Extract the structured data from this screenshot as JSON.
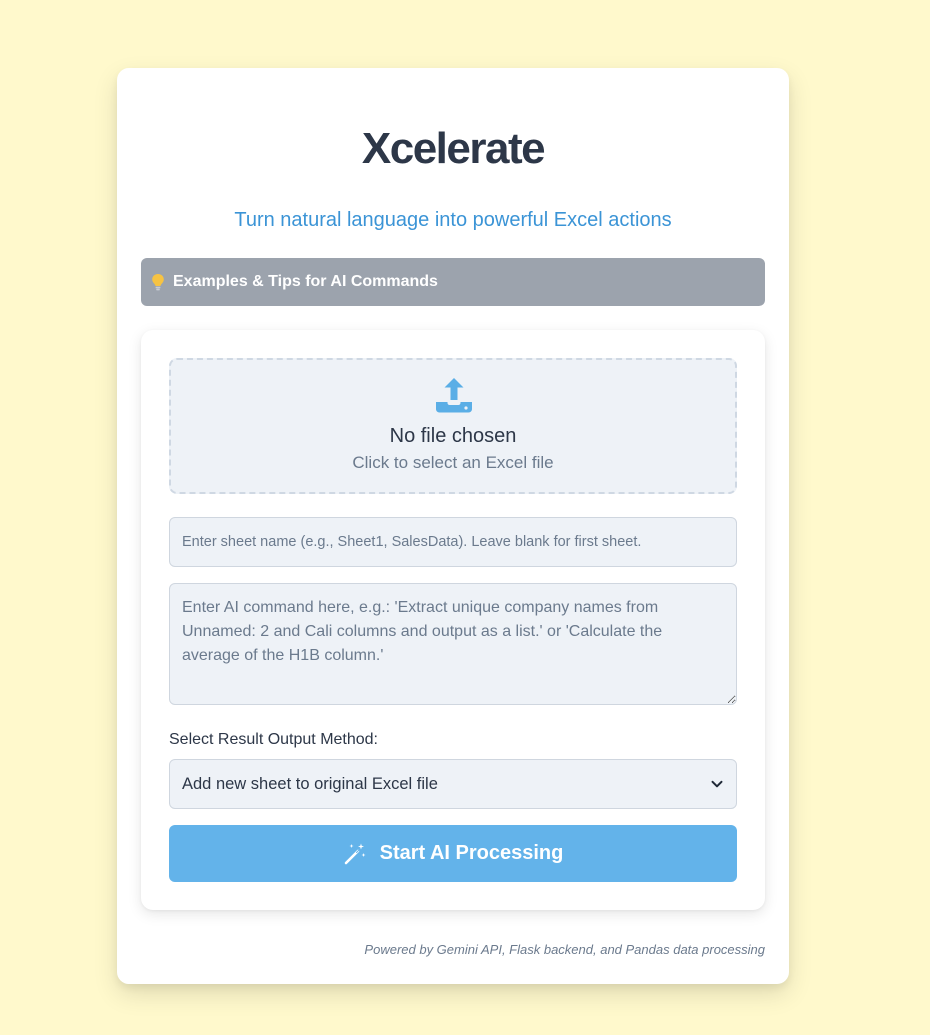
{
  "app": {
    "title": "Xcelerate",
    "subtitle": "Turn natural language into powerful Excel actions"
  },
  "tips": {
    "icon": "lightbulb-icon",
    "label": "Examples & Tips for AI Commands"
  },
  "upload": {
    "icon": "upload-icon",
    "status": "No file chosen",
    "hint": "Click to select an Excel file"
  },
  "sheet": {
    "value": "",
    "placeholder": "Enter sheet name (e.g., Sheet1, SalesData). Leave blank for first sheet."
  },
  "command": {
    "value": "",
    "placeholder": "Enter AI command here, e.g.: 'Extract unique company names from Unnamed: 2 and Cali columns and output as a list.' or 'Calculate the average of the H1B column.'"
  },
  "output": {
    "label": "Select Result Output Method:",
    "selected": "Add new sheet to original Excel file"
  },
  "action": {
    "icon": "magic-wand-icon",
    "label": "Start AI Processing"
  },
  "footer": {
    "note": "Powered by Gemini API, Flask backend, and Pandas data processing"
  },
  "colors": {
    "page_background": "#fff9cc",
    "accent": "#3b94d6",
    "button": "#63b3ea",
    "tips_bar": "#9ca3ad",
    "bulb": "#f6c343"
  }
}
